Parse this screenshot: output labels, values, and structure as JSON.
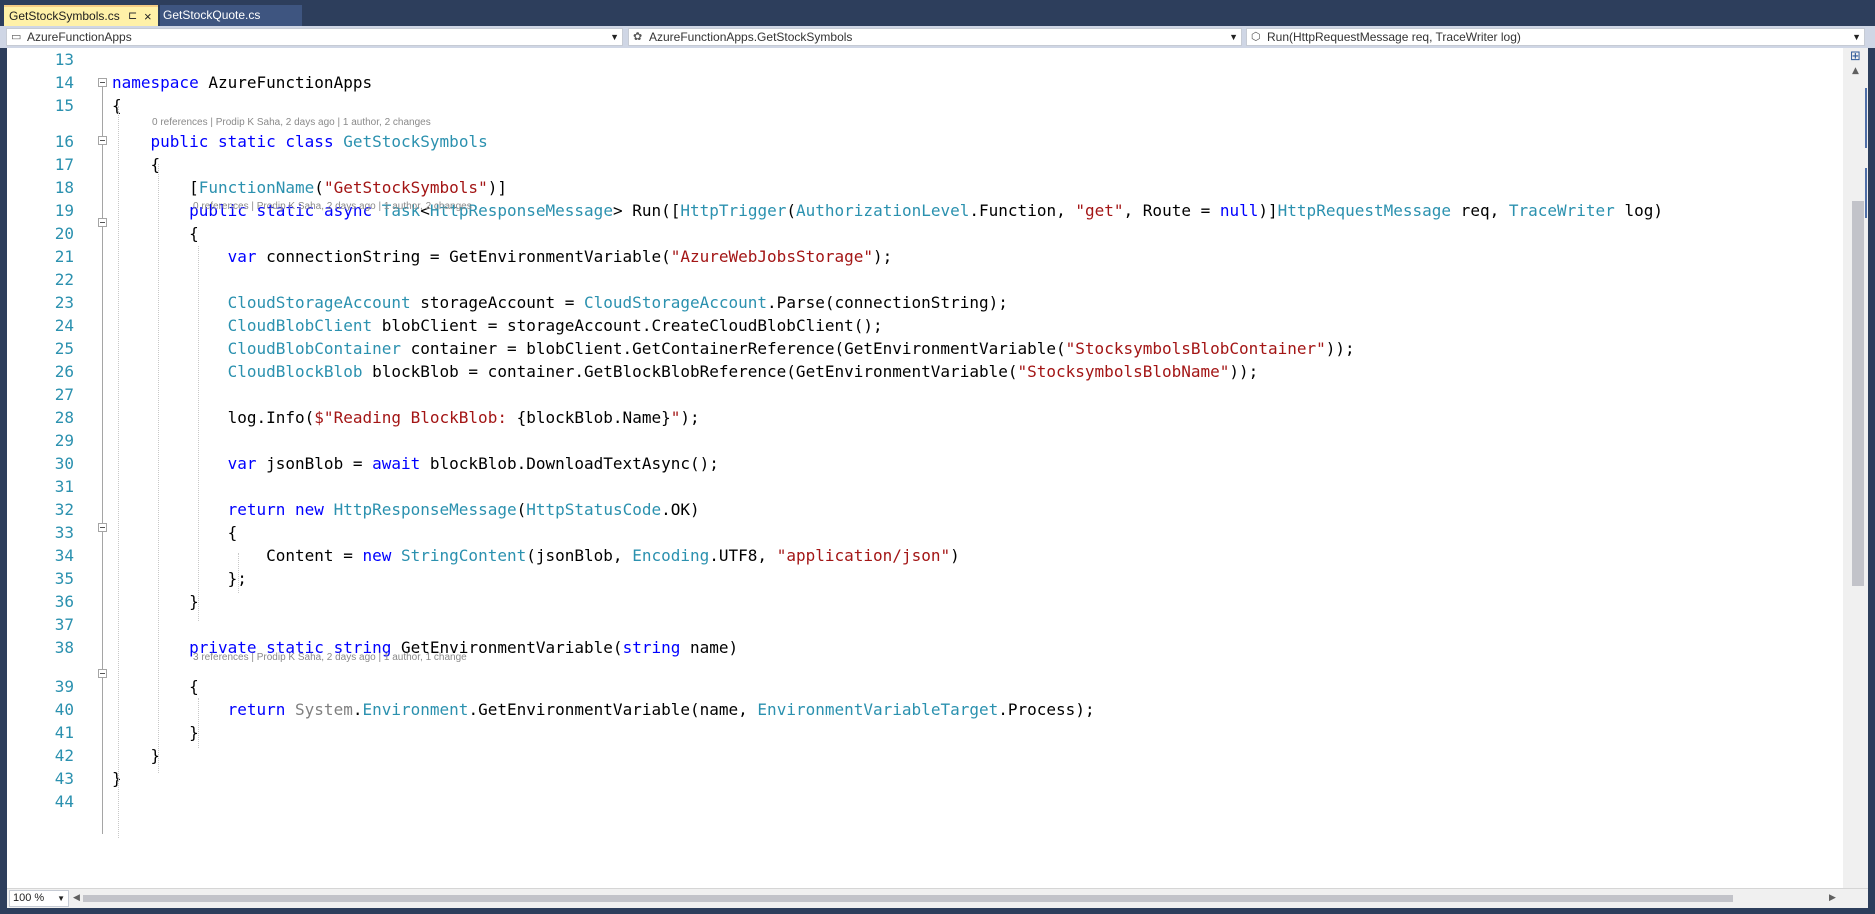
{
  "tabs": [
    {
      "label": "GetStockSymbols.cs",
      "active": true,
      "pin_icon": "pin-icon",
      "close_icon": "close-icon"
    },
    {
      "label": "GetStockQuote.cs",
      "active": false
    }
  ],
  "navbar": {
    "project": "AzureFunctionApps",
    "class": "AzureFunctionApps.GetStockSymbols",
    "member": "Run(HttpRequestMessage req, TraceWriter log)"
  },
  "codelens": {
    "class_info": "0 references | Prodip K Saha, 2 days ago | 1 author, 2 changes",
    "run_info": "0 references | Prodip K Saha, 2 days ago | 1 author, 2 changes",
    "env_info": "3 references | Prodip K Saha, 2 days ago | 1 author, 1 change"
  },
  "code_lines": [
    {
      "n": "13",
      "segs": []
    },
    {
      "n": "14",
      "segs": [
        {
          "c": "kw",
          "t": "namespace"
        },
        {
          "c": "",
          "t": " AzureFunctionApps"
        }
      ]
    },
    {
      "n": "15",
      "segs": [
        {
          "c": "",
          "t": "{"
        }
      ]
    },
    {
      "n": "16",
      "segs": [
        {
          "c": "",
          "t": "    "
        },
        {
          "c": "kw",
          "t": "public"
        },
        {
          "c": "",
          "t": " "
        },
        {
          "c": "kw",
          "t": "static"
        },
        {
          "c": "",
          "t": " "
        },
        {
          "c": "kw",
          "t": "class"
        },
        {
          "c": "",
          "t": " "
        },
        {
          "c": "ty",
          "t": "GetStockSymbols"
        }
      ]
    },
    {
      "n": "17",
      "segs": [
        {
          "c": "",
          "t": "    {"
        }
      ]
    },
    {
      "n": "18",
      "segs": [
        {
          "c": "",
          "t": "        ["
        },
        {
          "c": "ty",
          "t": "FunctionName"
        },
        {
          "c": "",
          "t": "("
        },
        {
          "c": "st",
          "t": "\"GetStockSymbols\""
        },
        {
          "c": "",
          "t": ")]"
        }
      ]
    },
    {
      "n": "19",
      "segs": [
        {
          "c": "",
          "t": "        "
        },
        {
          "c": "kw",
          "t": "public"
        },
        {
          "c": "",
          "t": " "
        },
        {
          "c": "kw",
          "t": "static"
        },
        {
          "c": "",
          "t": " "
        },
        {
          "c": "kw",
          "t": "async"
        },
        {
          "c": "",
          "t": " "
        },
        {
          "c": "ty",
          "t": "Task"
        },
        {
          "c": "",
          "t": "<"
        },
        {
          "c": "ty",
          "t": "HttpResponseMessage"
        },
        {
          "c": "",
          "t": "> Run(["
        },
        {
          "c": "ty",
          "t": "HttpTrigger"
        },
        {
          "c": "",
          "t": "("
        },
        {
          "c": "ty",
          "t": "AuthorizationLevel"
        },
        {
          "c": "",
          "t": ".Function, "
        },
        {
          "c": "st",
          "t": "\"get\""
        },
        {
          "c": "",
          "t": ", Route = "
        },
        {
          "c": "kw",
          "t": "null"
        },
        {
          "c": "",
          "t": ")]"
        },
        {
          "c": "ty",
          "t": "HttpRequestMessage"
        },
        {
          "c": "",
          "t": " req, "
        },
        {
          "c": "ty",
          "t": "TraceWriter"
        },
        {
          "c": "",
          "t": " log)"
        }
      ]
    },
    {
      "n": "20",
      "segs": [
        {
          "c": "",
          "t": "        {"
        }
      ]
    },
    {
      "n": "21",
      "segs": [
        {
          "c": "",
          "t": "            "
        },
        {
          "c": "kw",
          "t": "var"
        },
        {
          "c": "",
          "t": " connectionString = GetEnvironmentVariable("
        },
        {
          "c": "st",
          "t": "\"AzureWebJobsStorage\""
        },
        {
          "c": "",
          "t": ");"
        }
      ]
    },
    {
      "n": "22",
      "segs": []
    },
    {
      "n": "23",
      "segs": [
        {
          "c": "",
          "t": "            "
        },
        {
          "c": "ty",
          "t": "CloudStorageAccount"
        },
        {
          "c": "",
          "t": " storageAccount = "
        },
        {
          "c": "ty",
          "t": "CloudStorageAccount"
        },
        {
          "c": "",
          "t": ".Parse(connectionString);"
        }
      ]
    },
    {
      "n": "24",
      "segs": [
        {
          "c": "",
          "t": "            "
        },
        {
          "c": "ty",
          "t": "CloudBlobClient"
        },
        {
          "c": "",
          "t": " blobClient = storageAccount.CreateCloudBlobClient();"
        }
      ]
    },
    {
      "n": "25",
      "segs": [
        {
          "c": "",
          "t": "            "
        },
        {
          "c": "ty",
          "t": "CloudBlobContainer"
        },
        {
          "c": "",
          "t": " container = blobClient.GetContainerReference(GetEnvironmentVariable("
        },
        {
          "c": "st",
          "t": "\"StocksymbolsBlobContainer\""
        },
        {
          "c": "",
          "t": "));"
        }
      ]
    },
    {
      "n": "26",
      "segs": [
        {
          "c": "",
          "t": "            "
        },
        {
          "c": "ty",
          "t": "CloudBlockBlob"
        },
        {
          "c": "",
          "t": " blockBlob = container.GetBlockBlobReference(GetEnvironmentVariable("
        },
        {
          "c": "st",
          "t": "\"StocksymbolsBlobName\""
        },
        {
          "c": "",
          "t": "));"
        }
      ]
    },
    {
      "n": "27",
      "segs": []
    },
    {
      "n": "28",
      "segs": [
        {
          "c": "",
          "t": "            log.Info("
        },
        {
          "c": "st",
          "t": "$\"Reading BlockBlob: "
        },
        {
          "c": "",
          "t": "{blockBlob.Name}"
        },
        {
          "c": "st",
          "t": "\""
        },
        {
          "c": "",
          "t": ");"
        }
      ]
    },
    {
      "n": "29",
      "segs": []
    },
    {
      "n": "30",
      "segs": [
        {
          "c": "",
          "t": "            "
        },
        {
          "c": "kw",
          "t": "var"
        },
        {
          "c": "",
          "t": " jsonBlob = "
        },
        {
          "c": "kw",
          "t": "await"
        },
        {
          "c": "",
          "t": " blockBlob.DownloadTextAsync();"
        }
      ]
    },
    {
      "n": "31",
      "segs": []
    },
    {
      "n": "32",
      "segs": [
        {
          "c": "",
          "t": "            "
        },
        {
          "c": "kw",
          "t": "return"
        },
        {
          "c": "",
          "t": " "
        },
        {
          "c": "kw",
          "t": "new"
        },
        {
          "c": "",
          "t": " "
        },
        {
          "c": "ty",
          "t": "HttpResponseMessage"
        },
        {
          "c": "",
          "t": "("
        },
        {
          "c": "ty",
          "t": "HttpStatusCode"
        },
        {
          "c": "",
          "t": ".OK)"
        }
      ]
    },
    {
      "n": "33",
      "segs": [
        {
          "c": "",
          "t": "            {"
        }
      ]
    },
    {
      "n": "34",
      "segs": [
        {
          "c": "",
          "t": "                Content = "
        },
        {
          "c": "kw",
          "t": "new"
        },
        {
          "c": "",
          "t": " "
        },
        {
          "c": "ty",
          "t": "StringContent"
        },
        {
          "c": "",
          "t": "(jsonBlob, "
        },
        {
          "c": "ty",
          "t": "Encoding"
        },
        {
          "c": "",
          "t": ".UTF8, "
        },
        {
          "c": "st",
          "t": "\"application/json\""
        },
        {
          "c": "",
          "t": ")"
        }
      ]
    },
    {
      "n": "35",
      "segs": [
        {
          "c": "",
          "t": "            };"
        }
      ]
    },
    {
      "n": "36",
      "segs": [
        {
          "c": "",
          "t": "        }"
        }
      ]
    },
    {
      "n": "37",
      "segs": []
    },
    {
      "n": "38",
      "segs": [
        {
          "c": "",
          "t": "        "
        },
        {
          "c": "kw",
          "t": "private"
        },
        {
          "c": "",
          "t": " "
        },
        {
          "c": "kw",
          "t": "static"
        },
        {
          "c": "",
          "t": " "
        },
        {
          "c": "kw",
          "t": "string"
        },
        {
          "c": "",
          "t": " GetEnvironmentVariable("
        },
        {
          "c": "kw",
          "t": "string"
        },
        {
          "c": "",
          "t": " name)"
        }
      ]
    },
    {
      "n": "39",
      "segs": [
        {
          "c": "",
          "t": "        {"
        }
      ]
    },
    {
      "n": "40",
      "segs": [
        {
          "c": "",
          "t": "            "
        },
        {
          "c": "kw",
          "t": "return"
        },
        {
          "c": "",
          "t": " "
        },
        {
          "c": "gr",
          "t": "System"
        },
        {
          "c": "",
          "t": "."
        },
        {
          "c": "ty",
          "t": "Environment"
        },
        {
          "c": "",
          "t": ".GetEnvironmentVariable(name, "
        },
        {
          "c": "ty",
          "t": "EnvironmentVariableTarget"
        },
        {
          "c": "",
          "t": ".Process);"
        }
      ]
    },
    {
      "n": "41",
      "segs": [
        {
          "c": "",
          "t": "        }"
        }
      ]
    },
    {
      "n": "42",
      "segs": [
        {
          "c": "",
          "t": "    }"
        }
      ]
    },
    {
      "n": "43",
      "segs": [
        {
          "c": "",
          "t": "}"
        }
      ]
    },
    {
      "n": "44",
      "segs": []
    }
  ],
  "zoom": "100 %"
}
